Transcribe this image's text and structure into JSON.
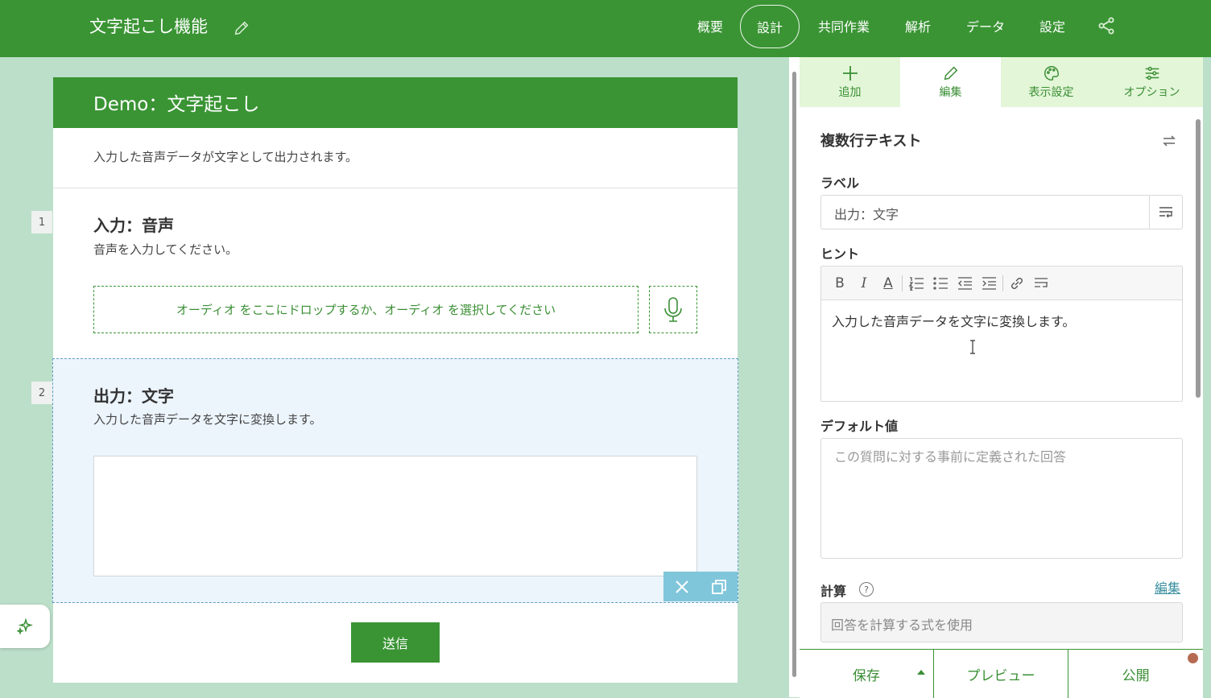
{
  "app": {
    "title": "文字起こし機能",
    "nav": [
      "概要",
      "設計",
      "共同作業",
      "解析",
      "データ",
      "設定"
    ],
    "active_nav": "設計"
  },
  "form": {
    "title": "Demo：文字起こし",
    "description": "入力した音声データが文字として出力されます。",
    "questions": [
      {
        "number": "1",
        "title": "入力：音声",
        "description": "音声を入力してください。",
        "dropzone_text": "オーディオ をここにドロップするか、オーディオ を選択してください"
      },
      {
        "number": "2",
        "title": "出力：文字",
        "description": "入力した音声データを文字に変換します。"
      }
    ],
    "submit_label": "送信"
  },
  "panel": {
    "tabs": [
      {
        "label": "追加",
        "icon": "plus-icon"
      },
      {
        "label": "編集",
        "icon": "pencil-icon"
      },
      {
        "label": "表示設定",
        "icon": "palette-icon"
      },
      {
        "label": "オプション",
        "icon": "sliders-icon"
      }
    ],
    "active_tab": "編集",
    "section_title": "複数行テキスト",
    "label_field": {
      "label": "ラベル",
      "value": "出力：文字"
    },
    "hint_field": {
      "label": "ヒント",
      "value": "入力した音声データを文字に変換します。"
    },
    "default_field": {
      "label": "デフォルト値",
      "placeholder": "この質問に対する事前に定義された回答"
    },
    "calc_field": {
      "label": "計算",
      "edit_link": "編集",
      "placeholder": "回答を計算する式を使用"
    },
    "bottom": {
      "save": "保存",
      "preview": "プレビュー",
      "publish": "公開"
    }
  },
  "colors": {
    "brand": "#3a9434",
    "background": "#bcdfca",
    "selected_question": "#ecf4fc",
    "action_bar": "#80c6db"
  }
}
